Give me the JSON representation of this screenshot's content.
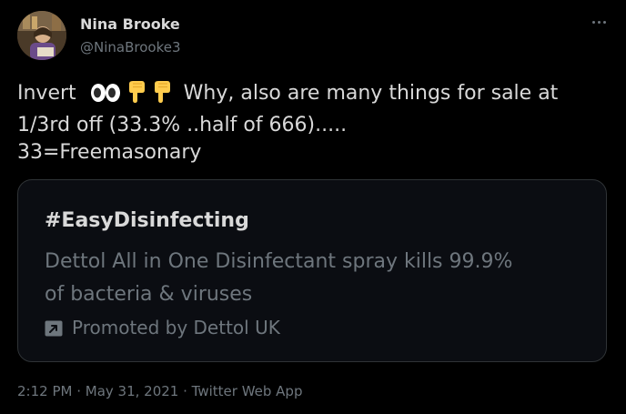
{
  "author": {
    "display_name": "Nina Brooke",
    "handle": "@NinaBrooke3",
    "avatar_icon": "profile-avatar"
  },
  "menu": {
    "icon": "more-options-icon"
  },
  "tweet": {
    "line1_prefix": "Invert",
    "line1_emojis": [
      "eyes-emoji",
      "backhand-index-pointing-down-emoji",
      "backhand-index-pointing-down-emoji"
    ],
    "line1_suffix": "Why, also are many things for sale at",
    "line2": "1/3rd off (33.3% ..half of 666).....",
    "line3": "33=Freemasonary"
  },
  "card": {
    "hashtag": "#EasyDisinfecting",
    "body_line1": "Dettol All in One Disinfectant spray kills 99.9%",
    "body_line2": "of bacteria & viruses",
    "promoted_icon": "promoted-icon",
    "promoted_text": "Promoted by Dettol UK"
  },
  "footer": {
    "time": "2:12 PM",
    "date": "May 31, 2021",
    "source": "Twitter Web App",
    "separator": " · "
  },
  "colors": {
    "background": "#000000",
    "primary_text": "#d9d9d9",
    "secondary_text": "#6e767d",
    "card_border": "#2f3336"
  }
}
